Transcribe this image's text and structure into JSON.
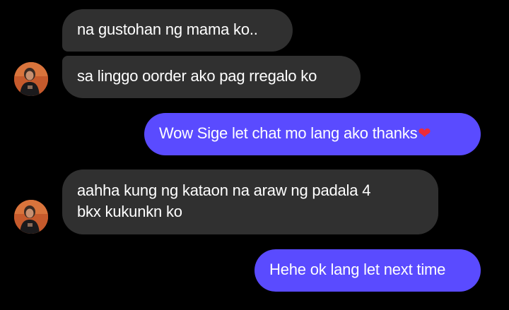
{
  "conversation": {
    "messages": [
      {
        "sender": "contact",
        "text": "na gustohan ng mama ko.."
      },
      {
        "sender": "contact",
        "text": "sa linggo oorder  ako pag rregalo ko"
      },
      {
        "sender": "me",
        "text": "Wow Sige let chat mo lang ako thanks",
        "emoji": "❤️"
      },
      {
        "sender": "contact",
        "line1": "aahha kung ng kataon  na araw ng padala 4",
        "line2": "bkx kukunkn ko"
      },
      {
        "sender": "me",
        "text": "Hehe ok lang let next time"
      }
    ]
  },
  "colors": {
    "background": "#000000",
    "incoming_bubble": "#303030",
    "outgoing_bubble": "#5a4bff",
    "heart": "#ef2b3a"
  },
  "icons": {
    "avatar": "contact-avatar-photo"
  }
}
